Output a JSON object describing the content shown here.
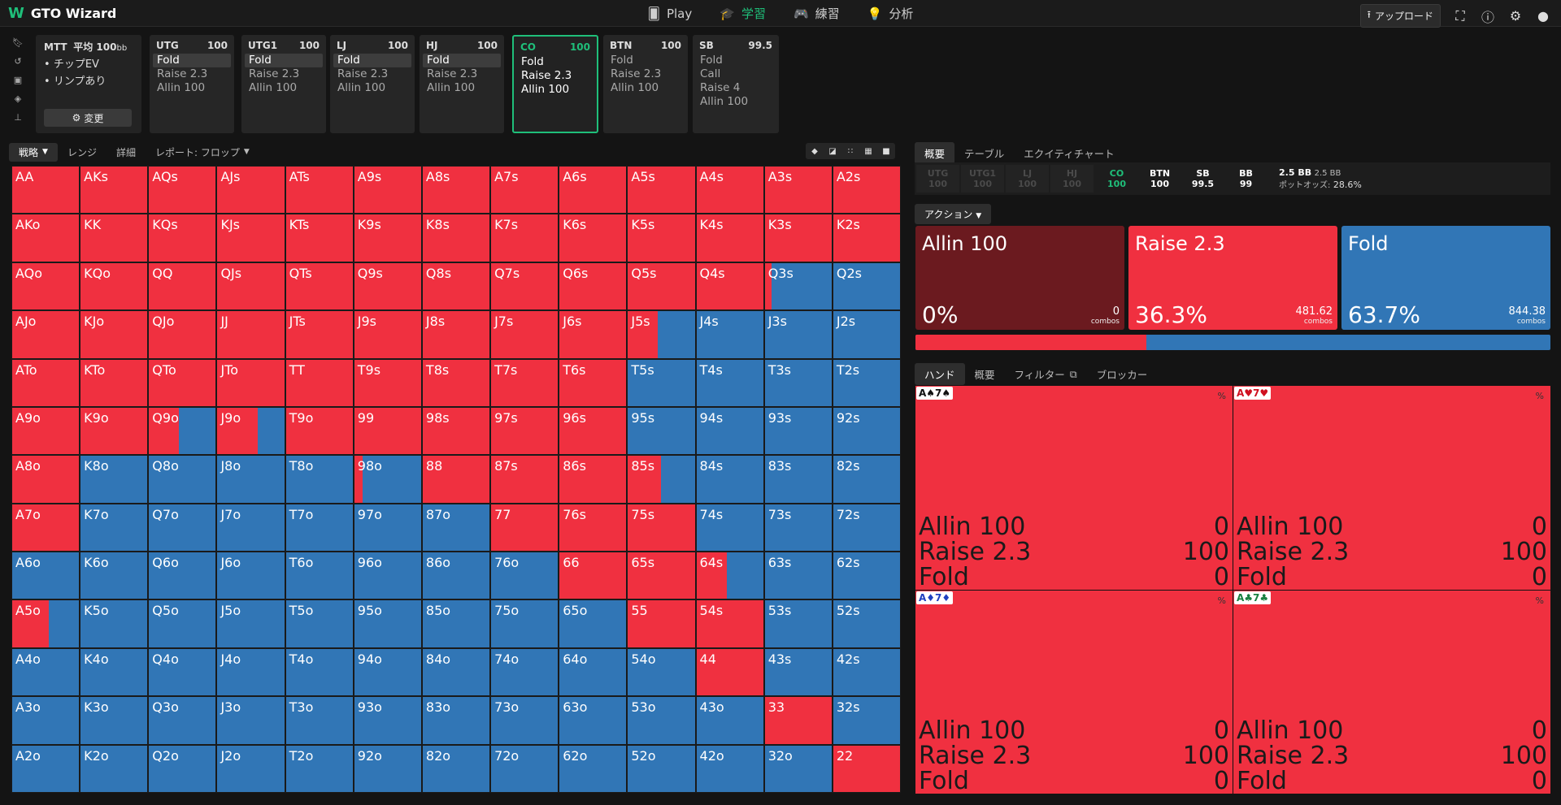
{
  "app": {
    "title": "GTO Wizard",
    "logo_mark": "W"
  },
  "nav": [
    {
      "label": "Play",
      "icon": "cards-icon",
      "glyph": "🂠",
      "active": false
    },
    {
      "label": "学習",
      "icon": "graduation-cap-icon",
      "glyph": "🎓",
      "active": true
    },
    {
      "label": "練習",
      "icon": "gamepad-icon",
      "glyph": "🎮",
      "active": false
    },
    {
      "label": "分析",
      "icon": "lightbulb-icon",
      "glyph": "💡",
      "active": false
    }
  ],
  "topright": {
    "upload_label": "アップロード"
  },
  "config": {
    "title": "MTT",
    "title2": "平均 100",
    "unit": "bb",
    "items": [
      "チップEV",
      "リンプあり"
    ],
    "change_label": "変更"
  },
  "positions": [
    {
      "name": "UTG",
      "stack": "100",
      "actions": [
        "Fold",
        "Raise 2.3",
        "Allin 100"
      ],
      "selected": 0,
      "active": false
    },
    {
      "name": "UTG1",
      "stack": "100",
      "actions": [
        "Fold",
        "Raise 2.3",
        "Allin 100"
      ],
      "selected": 0,
      "active": false
    },
    {
      "name": "LJ",
      "stack": "100",
      "actions": [
        "Fold",
        "Raise 2.3",
        "Allin 100"
      ],
      "selected": 0,
      "active": false
    },
    {
      "name": "HJ",
      "stack": "100",
      "actions": [
        "Fold",
        "Raise 2.3",
        "Allin 100"
      ],
      "selected": 0,
      "active": false
    },
    {
      "name": "CO",
      "stack": "100",
      "actions": [
        "Fold",
        "Raise 2.3",
        "Allin 100"
      ],
      "selected": -1,
      "active": true
    },
    {
      "name": "BTN",
      "stack": "100",
      "actions": [
        "Fold",
        "Raise 2.3",
        "Allin 100"
      ],
      "selected": -1,
      "active": false
    },
    {
      "name": "SB",
      "stack": "99.5",
      "actions": [
        "Fold",
        "Call",
        "Raise 4",
        "Allin 100"
      ],
      "selected": -1,
      "active": false
    }
  ],
  "left_tabs": {
    "strategy": "戦略",
    "range": "レンジ",
    "detail": "詳細",
    "report": "レポート: フロップ"
  },
  "matrix": {
    "labels": [
      [
        "AA",
        "AKs",
        "AQs",
        "AJs",
        "ATs",
        "A9s",
        "A8s",
        "A7s",
        "A6s",
        "A5s",
        "A4s",
        "A3s",
        "A2s"
      ],
      [
        "AKo",
        "KK",
        "KQs",
        "KJs",
        "KTs",
        "K9s",
        "K8s",
        "K7s",
        "K6s",
        "K5s",
        "K4s",
        "K3s",
        "K2s"
      ],
      [
        "AQo",
        "KQo",
        "QQ",
        "QJs",
        "QTs",
        "Q9s",
        "Q8s",
        "Q7s",
        "Q6s",
        "Q5s",
        "Q4s",
        "Q3s",
        "Q2s"
      ],
      [
        "AJo",
        "KJo",
        "QJo",
        "JJ",
        "JTs",
        "J9s",
        "J8s",
        "J7s",
        "J6s",
        "J5s",
        "J4s",
        "J3s",
        "J2s"
      ],
      [
        "ATo",
        "KTo",
        "QTo",
        "JTo",
        "TT",
        "T9s",
        "T8s",
        "T7s",
        "T6s",
        "T5s",
        "T4s",
        "T3s",
        "T2s"
      ],
      [
        "A9o",
        "K9o",
        "Q9o",
        "J9o",
        "T9o",
        "99",
        "98s",
        "97s",
        "96s",
        "95s",
        "94s",
        "93s",
        "92s"
      ],
      [
        "A8o",
        "K8o",
        "Q8o",
        "J8o",
        "T8o",
        "98o",
        "88",
        "87s",
        "86s",
        "85s",
        "84s",
        "83s",
        "82s"
      ],
      [
        "A7o",
        "K7o",
        "Q7o",
        "J7o",
        "T7o",
        "97o",
        "87o",
        "77",
        "76s",
        "75s",
        "74s",
        "73s",
        "72s"
      ],
      [
        "A6o",
        "K6o",
        "Q6o",
        "J6o",
        "T6o",
        "96o",
        "86o",
        "76o",
        "66",
        "65s",
        "64s",
        "63s",
        "62s"
      ],
      [
        "A5o",
        "K5o",
        "Q5o",
        "J5o",
        "T5o",
        "95o",
        "85o",
        "75o",
        "65o",
        "55",
        "54s",
        "53s",
        "52s"
      ],
      [
        "A4o",
        "K4o",
        "Q4o",
        "J4o",
        "T4o",
        "94o",
        "84o",
        "74o",
        "64o",
        "54o",
        "44",
        "43s",
        "42s"
      ],
      [
        "A3o",
        "K3o",
        "Q3o",
        "J3o",
        "T3o",
        "93o",
        "83o",
        "73o",
        "63o",
        "53o",
        "43o",
        "33",
        "32s"
      ],
      [
        "A2o",
        "K2o",
        "Q2o",
        "J2o",
        "T2o",
        "92o",
        "82o",
        "72o",
        "62o",
        "52o",
        "42o",
        "32o",
        "22"
      ]
    ],
    "raise": [
      [
        1,
        1,
        1,
        1,
        1,
        1,
        1,
        1,
        1,
        1,
        1,
        1,
        1
      ],
      [
        1,
        1,
        1,
        1,
        1,
        1,
        1,
        1,
        1,
        1,
        1,
        1,
        1
      ],
      [
        1,
        1,
        1,
        1,
        1,
        1,
        1,
        1,
        1,
        1,
        1,
        0.1,
        0
      ],
      [
        1,
        1,
        1,
        1,
        1,
        1,
        1,
        1,
        1,
        0.45,
        0,
        0,
        0
      ],
      [
        1,
        1,
        1,
        1,
        1,
        1,
        1,
        1,
        1,
        0,
        0,
        0,
        0
      ],
      [
        1,
        1,
        0.45,
        0.6,
        1,
        1,
        1,
        1,
        1,
        0,
        0,
        0,
        0
      ],
      [
        1,
        0,
        0,
        0,
        0,
        0.12,
        1,
        1,
        1,
        0.5,
        0,
        0,
        0
      ],
      [
        1,
        0,
        0,
        0,
        0,
        0,
        0,
        1,
        1,
        1,
        0,
        0,
        0
      ],
      [
        0,
        0,
        0,
        0,
        0,
        0,
        0,
        0,
        1,
        1,
        0.45,
        0,
        0
      ],
      [
        0.55,
        0,
        0,
        0,
        0,
        0,
        0,
        0,
        0,
        1,
        1,
        0,
        0
      ],
      [
        0,
        0,
        0,
        0,
        0,
        0,
        0,
        0,
        0,
        0,
        1,
        0,
        0
      ],
      [
        0,
        0,
        0,
        0,
        0,
        0,
        0,
        0,
        0,
        0,
        0,
        1,
        0
      ],
      [
        0,
        0,
        0,
        0,
        0,
        0,
        0,
        0,
        0,
        0,
        0,
        0,
        1
      ]
    ]
  },
  "right_tabs": {
    "overview": "概要",
    "table": "テーブル",
    "equity": "エクイティチャート"
  },
  "posbar": [
    {
      "name": "UTG",
      "val": "100",
      "dim": true
    },
    {
      "name": "UTG1",
      "val": "100",
      "dim": true
    },
    {
      "name": "LJ",
      "val": "100",
      "dim": true
    },
    {
      "name": "HJ",
      "val": "100",
      "dim": true
    },
    {
      "name": "CO",
      "val": "100",
      "dim": false,
      "co": true
    },
    {
      "name": "BTN",
      "val": "100",
      "dim": false
    },
    {
      "name": "SB",
      "val": "99.5",
      "dim": false
    },
    {
      "name": "BB",
      "val": "99",
      "dim": false
    }
  ],
  "pot": {
    "main": "2.5 BB",
    "sub": "2.5 BB",
    "odds_label": "ポットオッズ:",
    "odds": "28.6%"
  },
  "action_dropdown": "アクション",
  "actions": [
    {
      "name": "Allin 100",
      "pct": "0%",
      "combos": "0",
      "combos_label": "combos",
      "color": "#6b1a1f"
    },
    {
      "name": "Raise 2.3",
      "pct": "36.3%",
      "combos": "481.62",
      "combos_label": "combos",
      "color": "#f03040"
    },
    {
      "name": "Fold",
      "pct": "63.7%",
      "combos": "844.38",
      "combos_label": "combos",
      "color": "#3176b6"
    }
  ],
  "freq_raise": 0.363,
  "hand_tabs": {
    "hand": "ハンド",
    "overview": "概要",
    "filter": "フィルター",
    "blocker": "ブロッカー"
  },
  "hands": [
    {
      "card1": "A♠",
      "card2": "7♠",
      "color": "#111",
      "pct": "%",
      "rows": [
        [
          "Allin 100",
          "0"
        ],
        [
          "Raise 2.3",
          "100"
        ],
        [
          "Fold",
          "0"
        ]
      ]
    },
    {
      "card1": "A♥",
      "card2": "7♥",
      "color": "#d01020",
      "pct": "%",
      "rows": [
        [
          "Allin 100",
          "0"
        ],
        [
          "Raise 2.3",
          "100"
        ],
        [
          "Fold",
          "0"
        ]
      ]
    },
    {
      "card1": "A♦",
      "card2": "7♦",
      "color": "#2040c0",
      "pct": "%",
      "rows": [
        [
          "Allin 100",
          "0"
        ],
        [
          "Raise 2.3",
          "100"
        ],
        [
          "Fold",
          "0"
        ]
      ]
    },
    {
      "card1": "A♣",
      "card2": "7♣",
      "color": "#188040",
      "pct": "%",
      "rows": [
        [
          "Allin 100",
          "0"
        ],
        [
          "Raise 2.3",
          "100"
        ],
        [
          "Fold",
          "0"
        ]
      ]
    }
  ]
}
